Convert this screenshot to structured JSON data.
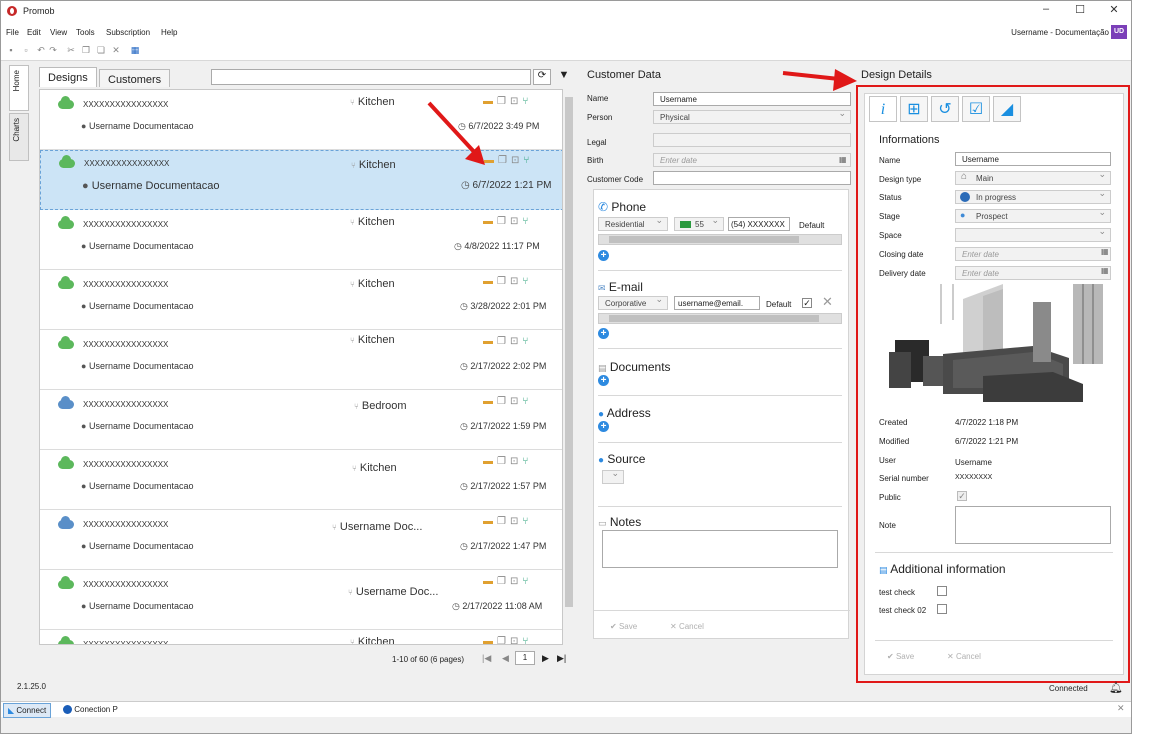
{
  "app": {
    "title": "Promob",
    "version": "2.1.25.0"
  },
  "menu": [
    "File",
    "Edit",
    "View",
    "Tools",
    "Subscription",
    "Help"
  ],
  "user": {
    "name": "Username - Documentação",
    "initials": "UD"
  },
  "side_tabs": {
    "home": "Home",
    "charts": "Charts"
  },
  "designs": {
    "tabs": [
      "Designs",
      "Customers"
    ],
    "rows": [
      {
        "code": "XXXXXXXXXXXXXXXX",
        "type": "Kitchen",
        "user": "Username Documentacao",
        "date": "6/7/2022 3:49 PM",
        "cloud": "#5cb85c"
      },
      {
        "code": "XXXXXXXXXXXXXXXX",
        "type": "Kitchen",
        "user": "Username Documentacao",
        "date": "6/7/2022 1:21 PM",
        "cloud": "#5cb85c"
      },
      {
        "code": "XXXXXXXXXXXXXXXX",
        "type": "Kitchen",
        "user": "Username Documentacao",
        "date": "4/8/2022 11:17 PM",
        "cloud": "#5cb85c"
      },
      {
        "code": "XXXXXXXXXXXXXXXX",
        "type": "Kitchen",
        "user": "Username Documentacao",
        "date": "3/28/2022 2:01 PM",
        "cloud": "#5cb85c"
      },
      {
        "code": "XXXXXXXXXXXXXXXX",
        "type": "Kitchen",
        "user": "Username Documentacao",
        "date": "2/17/2022 2:02 PM",
        "cloud": "#5cb85c"
      },
      {
        "code": "XXXXXXXXXXXXXXXX",
        "type": "Bedroom",
        "user": "Username Documentacao",
        "date": "2/17/2022 1:59 PM",
        "cloud": "#5a8fc8"
      },
      {
        "code": "XXXXXXXXXXXXXXXX",
        "type": "Kitchen",
        "user": "Username Documentacao",
        "date": "2/17/2022 1:57 PM",
        "cloud": "#5cb85c"
      },
      {
        "code": "XXXXXXXXXXXXXXXX",
        "type": "Username Doc...",
        "user": "Username Documentacao",
        "date": "2/17/2022 1:47 PM",
        "cloud": "#5a8fc8"
      },
      {
        "code": "XXXXXXXXXXXXXXXX",
        "type": "Username Doc...",
        "user": "Username Documentacao",
        "date": "2/17/2022 11:08 AM",
        "cloud": "#5cb85c"
      },
      {
        "code": "XXXXXXXXXXXXXXXX",
        "type": "Kitchen",
        "user": "",
        "date": "",
        "cloud": "#5cb85c"
      }
    ],
    "pagination": "1-10 of 60 (6 pages)",
    "page": "1"
  },
  "customer": {
    "title": "Customer Data",
    "name_label": "Name",
    "name_value": "Username",
    "person_label": "Person",
    "person_value": "Physical",
    "legal_label": "Legal",
    "birth_label": "Birth",
    "birth_placeholder": "Enter date",
    "code_label": "Customer Code",
    "phone_title": "Phone",
    "phone_type": "Residential",
    "phone_ddi": "55",
    "phone_number": "(54) XXXXXXX",
    "phone_default": "Default",
    "email_title": "E-mail",
    "email_type": "Corporative",
    "email_value": "username@email.",
    "email_default": "Default",
    "documents_title": "Documents",
    "address_title": "Address",
    "source_title": "Source",
    "notes_title": "Notes",
    "save": "Save",
    "cancel": "Cancel"
  },
  "details": {
    "title": "Design Details",
    "section": "Informations",
    "name_label": "Name",
    "name_value": "Username",
    "type_label": "Design type",
    "type_value": "Main",
    "status_label": "Status",
    "status_value": "In progress",
    "stage_label": "Stage",
    "stage_value": "Prospect",
    "space_label": "Space",
    "closing_label": "Closing date",
    "closing_placeholder": "Enter date",
    "delivery_label": "Delivery date",
    "delivery_placeholder": "Enter date",
    "created_label": "Created",
    "created_value": "4/7/2022 1:18 PM",
    "modified_label": "Modified",
    "modified_value": "6/7/2022 1:21 PM",
    "user_label": "User",
    "user_value": "Username",
    "serial_label": "Serial number",
    "serial_value": "XXXXXXXX",
    "public_label": "Public",
    "note_label": "Note",
    "additional_title": "Additional information",
    "check1": "test check",
    "check2": "test check 02",
    "save": "Save",
    "cancel": "Cancel"
  },
  "status": {
    "connected": "Connected",
    "connect": "Connect",
    "conection": "Conection P"
  },
  "colors": {
    "accent": "#2d8ae0",
    "highlight_border": "#e01818",
    "selected_row": "#cce4f6"
  }
}
